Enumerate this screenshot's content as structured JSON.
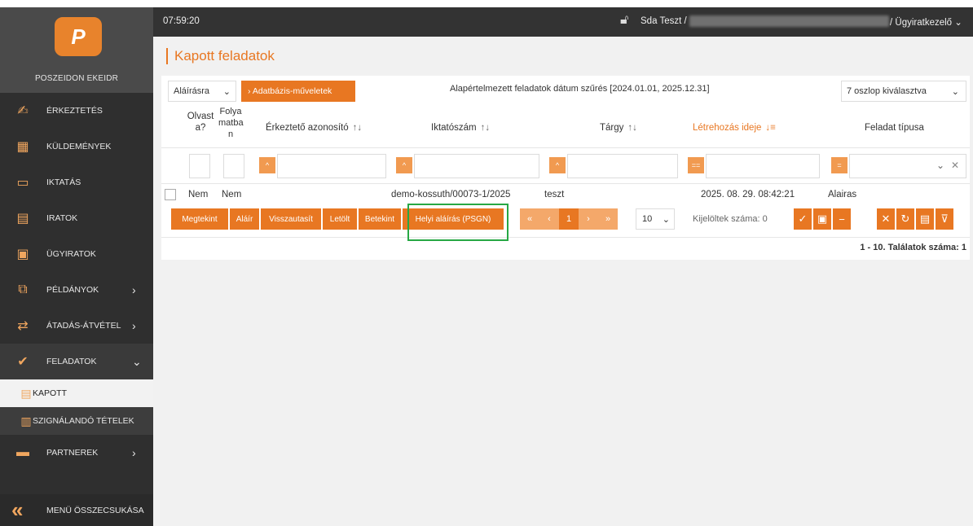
{
  "sidebar": {
    "logo_text": "POSZEIDON EKEIDR",
    "items": [
      {
        "label": "ÉRKEZTETÉS",
        "icon": "stamp-icon"
      },
      {
        "label": "KÜLDEMÉNYEK",
        "icon": "package-icon"
      },
      {
        "label": "IKTATÁS",
        "icon": "book-icon"
      },
      {
        "label": "IRATOK",
        "icon": "documents-icon"
      },
      {
        "label": "ÜGYIRATOK",
        "icon": "folder-icon"
      },
      {
        "label": "PÉLDÁNYOK",
        "icon": "copies-icon",
        "chevron": "›"
      },
      {
        "label": "ÁTADÁS-ÁTVÉTEL",
        "icon": "handover-icon",
        "chevron": "›"
      },
      {
        "label": "FELADATOK",
        "icon": "tasks-icon",
        "chevron": "⌄"
      }
    ],
    "sub_items": [
      {
        "label": "KAPOTT",
        "icon": "clipboard-list-icon"
      },
      {
        "label": "SZIGNÁLANDÓ TÉTELEK",
        "icon": "clipboard-sign-icon"
      }
    ],
    "partners": {
      "label": "PARTNEREK",
      "icon": "partners-icon",
      "chevron": "›"
    },
    "collapse_label": "MENÜ ÖSSZECSUKÁSA"
  },
  "topbar": {
    "time": "07:59:20",
    "user": "Sda Teszt /",
    "role": "/ Ügyiratkezelő ⌄"
  },
  "page": {
    "title": "Kapott feladatok"
  },
  "toolbar": {
    "mode_select": "Aláírásra",
    "db_button": "›  Adatbázis-műveletek",
    "filter_text": "Alapértelmezett feladatok dátum szűrés [2024.01.01, 2025.12.31]",
    "columns_select": "7 oszlop kiválasztva"
  },
  "table": {
    "headers": {
      "olvasta_1": "Olvast",
      "olvasta_2": "a?",
      "folyamatban_1": "Folya",
      "folyamatban_2": "matba",
      "folyamatban_3": "n",
      "erkezteto": "Érkeztető azonosító",
      "iktatoszam": "Iktatószám",
      "targy": "Tárgy",
      "letrehozas": "Létrehozás ideje",
      "feladat_tipusa": "Feladat típusa"
    },
    "sort_icon": "↑↓",
    "sort_active_icon": "↓≡",
    "filter_btn_labels": [
      "^",
      "^",
      "^",
      "^",
      "==",
      "="
    ],
    "row": {
      "olvasta": "Nem",
      "folyamatban": "Nem",
      "iktatoszam": "demo-kossuth/00073-1/2025",
      "targy": "teszt",
      "letrehozas": "2025. 08. 29. 08:42:21",
      "feladat_tipusa": "Alairas"
    }
  },
  "actions": {
    "megtekint": "Megtekint",
    "alair": "Aláír",
    "visszautasit": "Visszautasít",
    "letolt": "Letölt",
    "betekint": "Betekint",
    "helyi_alairas": "Helyi aláírás (PSGN)"
  },
  "pagination": {
    "first": "«",
    "prev": "‹",
    "current": "1",
    "next": "›",
    "last": "»",
    "page_size": "10",
    "selected_count": "Kijelöltek száma: 0",
    "results": "1 - 10. Találatok száma: 1"
  },
  "colors": {
    "accent": "#e87722",
    "highlight": "#27a844"
  }
}
